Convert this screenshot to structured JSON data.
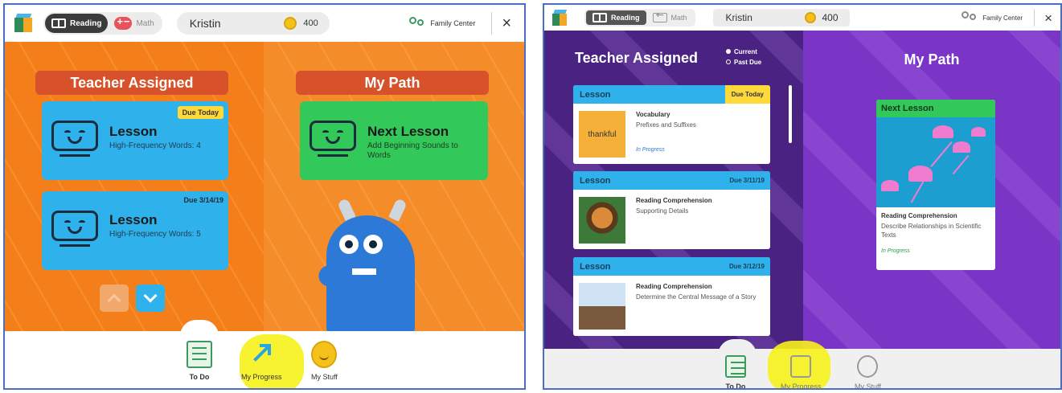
{
  "left_screenshot": {
    "topbar": {
      "reading_label": "Reading",
      "math_label": "Math",
      "user_name": "Kristin",
      "coins": "400",
      "family_center": "Family Center",
      "close": "×"
    },
    "teacher_assigned": {
      "title": "Teacher Assigned",
      "cards": [
        {
          "title": "Lesson",
          "subtitle": "High-Frequency Words: 4",
          "due": "Due Today"
        },
        {
          "title": "Lesson",
          "subtitle": "High-Frequency Words: 5",
          "due": "Due 3/14/19"
        }
      ]
    },
    "my_path": {
      "title": "My Path",
      "card": {
        "title": "Next Lesson",
        "subtitle": "Add Beginning Sounds to Words"
      }
    },
    "bottom_nav": [
      {
        "label": "To Do",
        "icon": "todo-icon"
      },
      {
        "label": "My Progress",
        "icon": "progress-arrow-icon"
      },
      {
        "label": "My Stuff",
        "icon": "smiley-icon"
      }
    ]
  },
  "right_screenshot": {
    "topbar": {
      "reading_label": "Reading",
      "math_label": "Math",
      "user_name": "Kristin",
      "coins": "400",
      "family_center": "Family Center",
      "close": "×"
    },
    "teacher_assigned": {
      "title": "Teacher Assigned",
      "legend_current": "Current",
      "legend_past_due": "Past Due",
      "cards": [
        {
          "type": "Lesson",
          "due": "Due Today",
          "skill": "Vocabulary",
          "topic": "Prefixes and Suffixes",
          "status": "In Progress",
          "thumb_text": "thankful"
        },
        {
          "type": "Lesson",
          "due": "Due 3/11/19",
          "skill": "Reading Comprehension",
          "topic": "Supporting Details",
          "status": ""
        },
        {
          "type": "Lesson",
          "due": "Due 3/12/19",
          "skill": "Reading Comprehension",
          "topic": "Determine the Central Message of a Story",
          "status": ""
        }
      ]
    },
    "my_path": {
      "title": "My Path",
      "card": {
        "header": "Next Lesson",
        "skill": "Reading Comprehension",
        "topic": "Describe Relationships in Scientific Texts",
        "status": "In Progress"
      }
    },
    "bottom_nav": [
      {
        "label": "To Do",
        "icon": "todo-icon"
      },
      {
        "label": "My Progress",
        "icon": "progress-icon"
      },
      {
        "label": "My Stuff",
        "icon": "smiley-icon"
      }
    ]
  },
  "colors": {
    "orange_bg": "#f47e1a",
    "purple_bg": "#4a2382",
    "lesson_blue": "#2fb2ec",
    "next_green": "#33c85a",
    "header_red": "#d7522a",
    "highlight_yellow": "#f7f21a"
  }
}
